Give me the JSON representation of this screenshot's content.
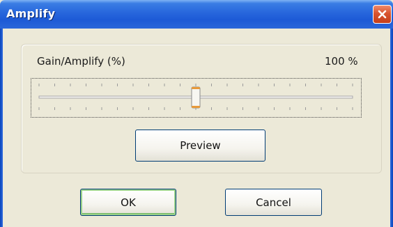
{
  "window": {
    "title": "Amplify"
  },
  "gain": {
    "label": "Gain/Amplify  (%)",
    "value_text": "100 %",
    "slider_fraction": 0.5
  },
  "buttons": {
    "preview_label": "Preview",
    "ok_label": "OK",
    "cancel_label": "Cancel"
  },
  "colors": {
    "titlebar": "#2766dc",
    "close_button": "#d8542f",
    "dialog_bg": "#ece9d8",
    "slider_thumb_accent": "#e89a3a"
  }
}
